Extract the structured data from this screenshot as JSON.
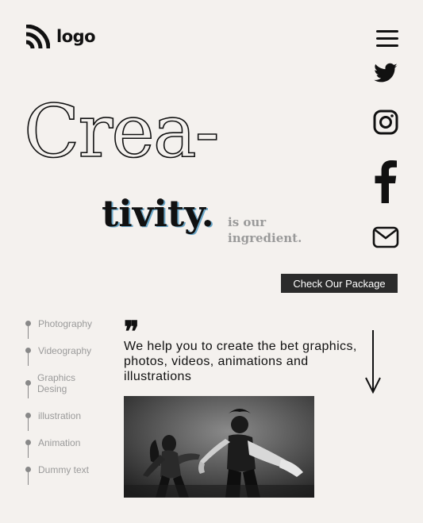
{
  "header": {
    "logo_text": "logo",
    "logo_icon": "rss-arcs-icon",
    "menu_icon": "hamburger-menu-icon"
  },
  "social": [
    {
      "name": "twitter",
      "icon": "twitter-icon"
    },
    {
      "name": "instagram",
      "icon": "instagram-icon"
    },
    {
      "name": "facebook",
      "icon": "facebook-icon"
    },
    {
      "name": "email",
      "icon": "mail-icon"
    }
  ],
  "hero": {
    "line1": "Crea-",
    "line2": "tivity.",
    "tagline_1": "is our",
    "tagline_2": "ingredient.",
    "cta_label": "Check Our Package"
  },
  "services": [
    {
      "label": "Photography"
    },
    {
      "label": "Videography"
    },
    {
      "label": "Graphics Desing"
    },
    {
      "label": "illustration"
    },
    {
      "label": "Animation"
    },
    {
      "label": "Dummy text"
    }
  ],
  "quote": {
    "mark": "❞",
    "text": "We help you to create the bet graphics, photos, videos, animations and illustrations"
  },
  "scroll_icon": "arrow-down-icon",
  "colors": {
    "background": "#f4f1ee",
    "text": "#111111",
    "muted": "#9a9a9a",
    "button": "#2b2b2b"
  }
}
